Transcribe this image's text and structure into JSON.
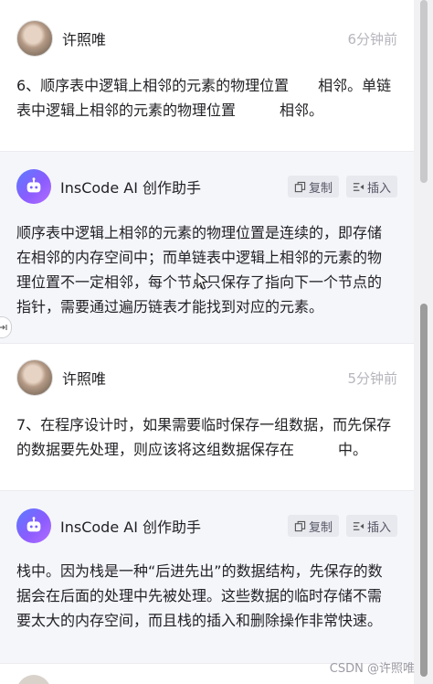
{
  "messages": [
    {
      "type": "user",
      "name": "许照唯",
      "time": "6分钟前",
      "text": "6、顺序表中逻辑上相邻的元素的物理位置　　相邻。单链表中逻辑上相邻的元素的物理位置　　　相邻。"
    },
    {
      "type": "ai",
      "name": "InsCode AI 创作助手",
      "copy_label": "复制",
      "insert_label": "插入",
      "text": "顺序表中逻辑上相邻的元素的物理位置是连续的，即存储在相邻的内存空间中；而单链表中逻辑上相邻的元素的物理位置不一定相邻，每个节点只保存了指向下一个节点的指针，需要通过遍历链表才能找到对应的元素。"
    },
    {
      "type": "user",
      "name": "许照唯",
      "time": "5分钟前",
      "text": "7、在程序设计时，如果需要临时保存一组数据，而先保存的数据要先处理，则应该将这组数据保存在　　　中。"
    },
    {
      "type": "ai",
      "name": "InsCode AI 创作助手",
      "copy_label": "复制",
      "insert_label": "插入",
      "text": "栈中。因为栈是一种“后进先出”的数据结构，先保存的数据会在后面的处理中先被处理。这些数据的临时存储不需要太大的内存空间，而且栈的插入和删除操作非常快速。"
    }
  ],
  "watermark": "CSDN @许照唯",
  "icons": {
    "copy": "copy-icon",
    "insert": "insert-icon",
    "robot": "robot-icon",
    "collapse": "collapse-arrow-icon"
  },
  "colors": {
    "ai_bg": "#f5f6fa",
    "time": "#b5b5bd",
    "ai_avatar": "#6e6cff"
  }
}
